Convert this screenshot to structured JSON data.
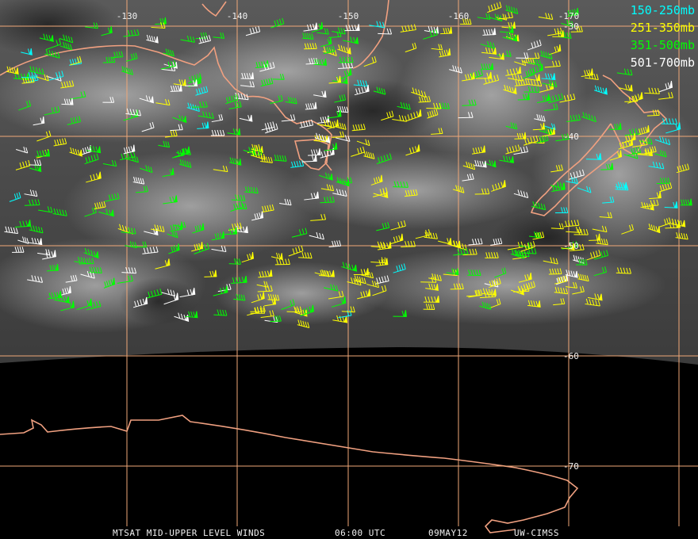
{
  "grid": {
    "longitudes": [
      "-130",
      "-140",
      "-150",
      "-160",
      "-170"
    ],
    "latitudes": [
      "-30",
      "-40",
      "-50",
      "-60",
      "-70"
    ],
    "color": "#f0a878"
  },
  "legend": [
    {
      "label": "150-250mb",
      "color": "#00ffff"
    },
    {
      "label": "251-350mb",
      "color": "#ffff00"
    },
    {
      "label": "351-500mb",
      "color": "#00ff00"
    },
    {
      "label": "501-700mb",
      "color": "#ffffff"
    }
  ],
  "footer": {
    "product": "MTSAT MID-UPPER LEVEL WINDS",
    "time": "06:00 UTC",
    "date": "09MAY12",
    "source": "UW-CIMSS"
  }
}
